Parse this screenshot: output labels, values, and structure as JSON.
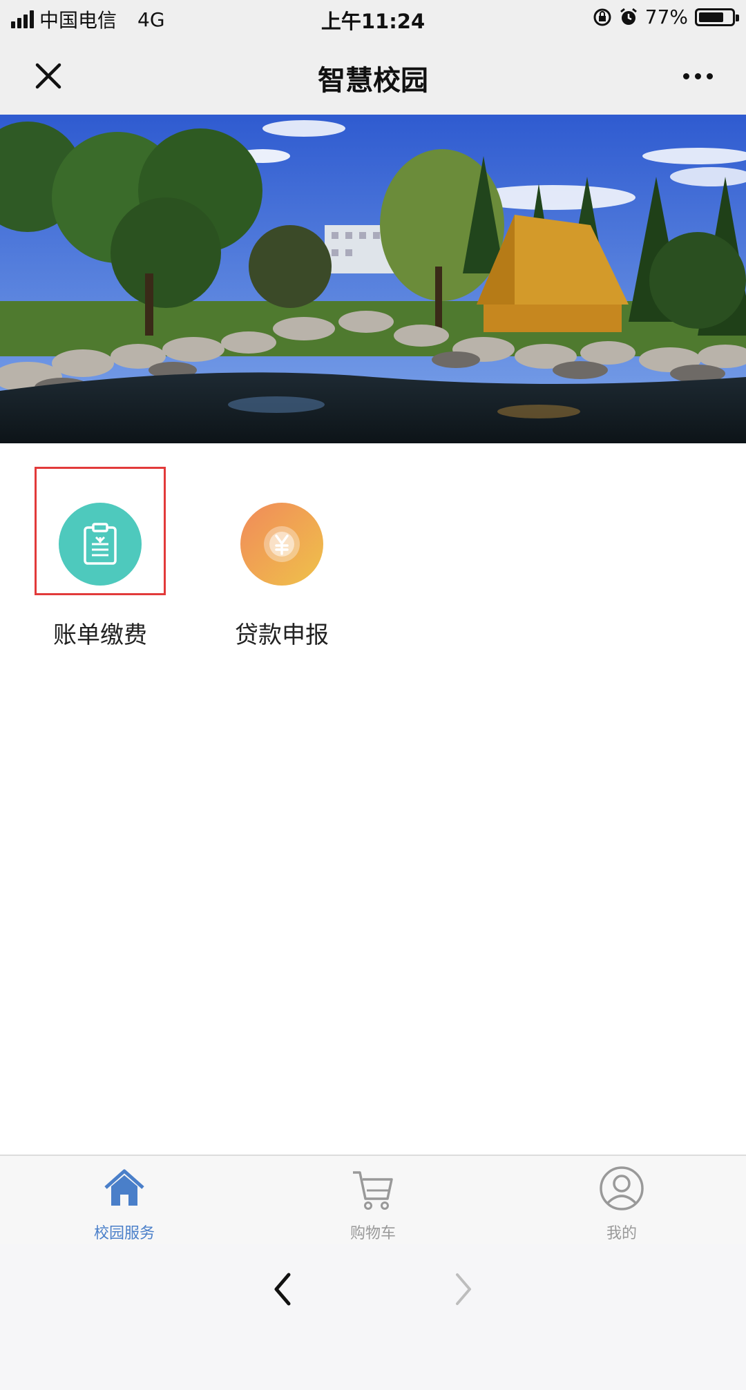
{
  "status_bar": {
    "carrier": "中国电信",
    "network": "4G",
    "time": "上午11:24",
    "battery_percent": "77%",
    "battery_level": 0.77,
    "icons": [
      "signal-icon",
      "rotation-lock-icon",
      "alarm-icon",
      "battery-icon"
    ]
  },
  "nav": {
    "title": "智慧校园",
    "close_icon": "close-icon",
    "more_icon": "more-icon"
  },
  "services": [
    {
      "label": "账单缴费",
      "icon": "bill-icon",
      "color": "#4ec9bd"
    },
    {
      "label": "贷款申报",
      "icon": "yuan-coin-icon",
      "color": "#efb24f"
    }
  ],
  "tabs": [
    {
      "label": "校园服务",
      "icon": "home-icon",
      "active": true
    },
    {
      "label": "购物车",
      "icon": "cart-icon",
      "active": false
    },
    {
      "label": "我的",
      "icon": "user-icon",
      "active": false
    }
  ],
  "colors": {
    "accent": "#4a7fc9",
    "highlight": "#e23a3a",
    "inactive_tab": "#999999"
  }
}
